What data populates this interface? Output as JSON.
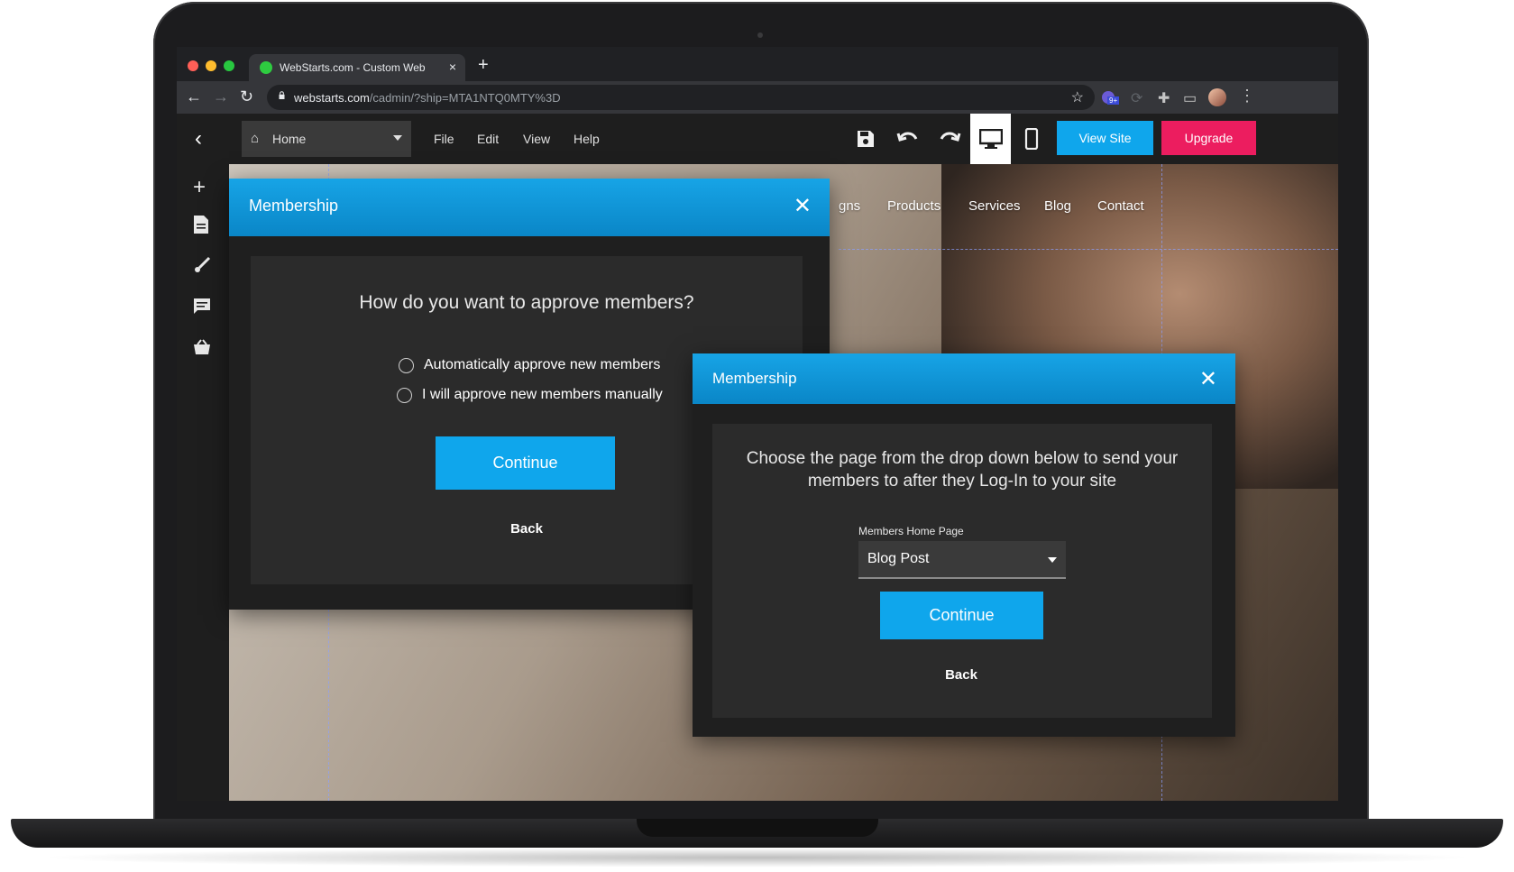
{
  "browser": {
    "tab_title": "WebStarts.com - Custom Web",
    "tab_close": "×",
    "new_tab": "+",
    "url_host": "webstarts.com",
    "url_path": "/cadmin/?ship=MTA1NTQ0MTY%3D",
    "back": "←",
    "forward": "→",
    "reload": "↻",
    "star": "☆",
    "extension_badge": "9+",
    "menu_dots": "⋮"
  },
  "editor": {
    "back_chevron": "‹",
    "page_selector": "Home",
    "menu": [
      "File",
      "Edit",
      "View",
      "Help"
    ],
    "view_site": "View Site",
    "upgrade": "Upgrade"
  },
  "site_nav": {
    "partial_item": "gns",
    "items": [
      "Products",
      "Services",
      "Blog",
      "Contact"
    ]
  },
  "dialog_approve": {
    "title": "Membership",
    "close": "✕",
    "question": "How do you want to approve members?",
    "options": [
      "Automatically approve new members",
      "I will approve new members manually"
    ],
    "continue": "Continue",
    "back": "Back"
  },
  "dialog_homepage": {
    "title": "Membership",
    "close": "✕",
    "instruction": "Choose the page from the drop down below to send your members to after they Log-In to your site",
    "field_label": "Members Home Page",
    "selected_page": "Blog Post",
    "continue": "Continue",
    "back": "Back"
  },
  "colors": {
    "accent_blue": "#0fa6ec",
    "upgrade_pink": "#ec1d5f",
    "dialog_bg": "#2b2b2b"
  }
}
